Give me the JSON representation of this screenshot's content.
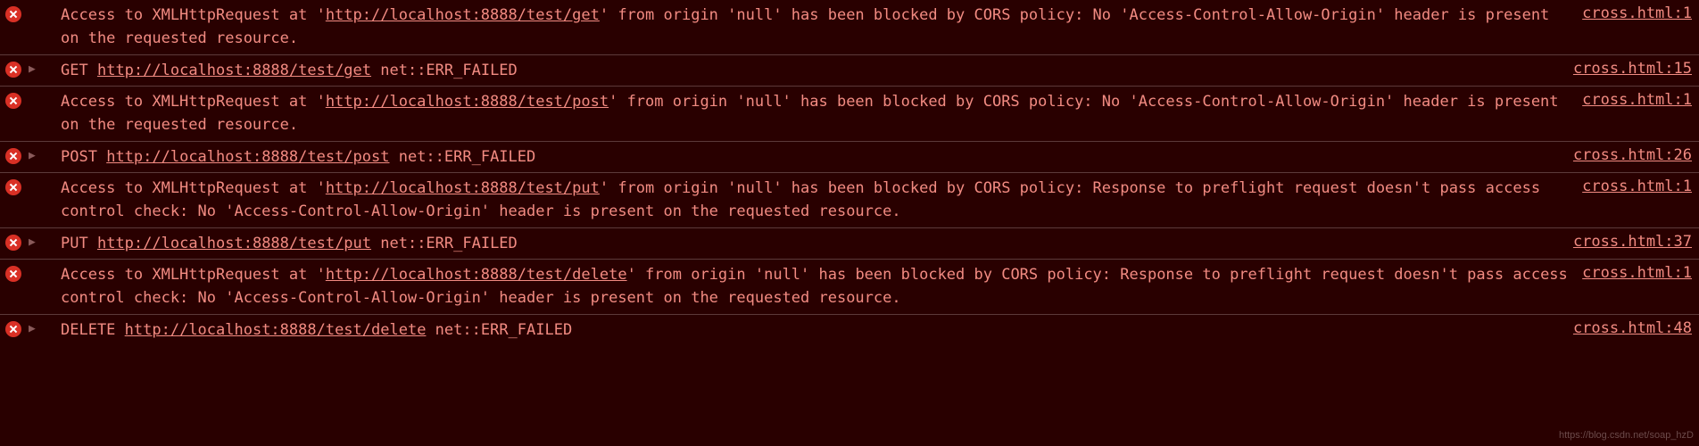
{
  "entries": [
    {
      "type": "cors",
      "msg_pre": "Access to XMLHttpRequest at '",
      "url": "http://localhost:8888/test/get",
      "msg_mid": "' from origin 'null' has been blocked by CORS policy: No 'Access-Control-Allow-Origin' header is present on the requested resource.",
      "source": "cross.html:1"
    },
    {
      "type": "net",
      "expand": "▶",
      "method": "GET",
      "url": "http://localhost:8888/test/get",
      "suffix": " net::ERR_FAILED",
      "source": "cross.html:15"
    },
    {
      "type": "cors",
      "msg_pre": "Access to XMLHttpRequest at '",
      "url": "http://localhost:8888/test/post",
      "msg_mid": "' from origin 'null' has been blocked by CORS policy: No 'Access-Control-Allow-Origin' header is present on the requested resource.",
      "source": "cross.html:1"
    },
    {
      "type": "net",
      "expand": "▶",
      "method": "POST",
      "url": "http://localhost:8888/test/post",
      "suffix": " net::ERR_FAILED",
      "source": "cross.html:26"
    },
    {
      "type": "cors",
      "msg_pre": "Access to XMLHttpRequest at '",
      "url": "http://localhost:8888/test/put",
      "msg_mid": "' from origin 'null' has been blocked by CORS policy: Response to preflight request doesn't pass access control check: No 'Access-Control-Allow-Origin' header is present on the requested resource.",
      "source": "cross.html:1"
    },
    {
      "type": "net",
      "expand": "▶",
      "method": "PUT",
      "url": "http://localhost:8888/test/put",
      "suffix": " net::ERR_FAILED",
      "source": "cross.html:37"
    },
    {
      "type": "cors",
      "msg_pre": "Access to XMLHttpRequest at '",
      "url": "http://localhost:8888/test/delete",
      "msg_mid": "' from origin 'null' has been blocked by CORS policy: Response to preflight request doesn't pass access control check: No 'Access-Control-Allow-Origin' header is present on the requested resource.",
      "source": "cross.html:1"
    },
    {
      "type": "net",
      "expand": "▶",
      "method": "DELETE",
      "url": "http://localhost:8888/test/delete",
      "suffix": " net::ERR_FAILED",
      "source": "cross.html:48"
    }
  ],
  "watermark": "https://blog.csdn.net/soap_hzD"
}
